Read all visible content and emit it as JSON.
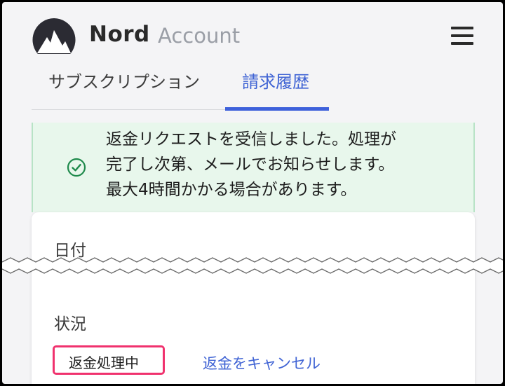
{
  "header": {
    "brand_primary": "Nord",
    "brand_secondary": "Account",
    "logo_icon": "nord-mountain-logo",
    "menu_icon": "hamburger-menu-icon"
  },
  "tabs": [
    {
      "label": "サブスクリプション",
      "active": false
    },
    {
      "label": "請求履歴",
      "active": true
    }
  ],
  "alert": {
    "icon": "check-circle-icon",
    "lines": [
      "返金リクエストを受信しました。処理が",
      "完了し次第、メールでお知らせします。",
      "最大4時間かかる場合があります。"
    ]
  },
  "card": {
    "date_label": "日付",
    "status_label": "状況",
    "status_badge": "返金処理中",
    "cancel_link": "返金をキャンセル"
  },
  "colors": {
    "accent": "#3e61db",
    "alert_bg": "#e8f7ec",
    "success": "#1f8a4c",
    "highlight": "#f0326e"
  }
}
